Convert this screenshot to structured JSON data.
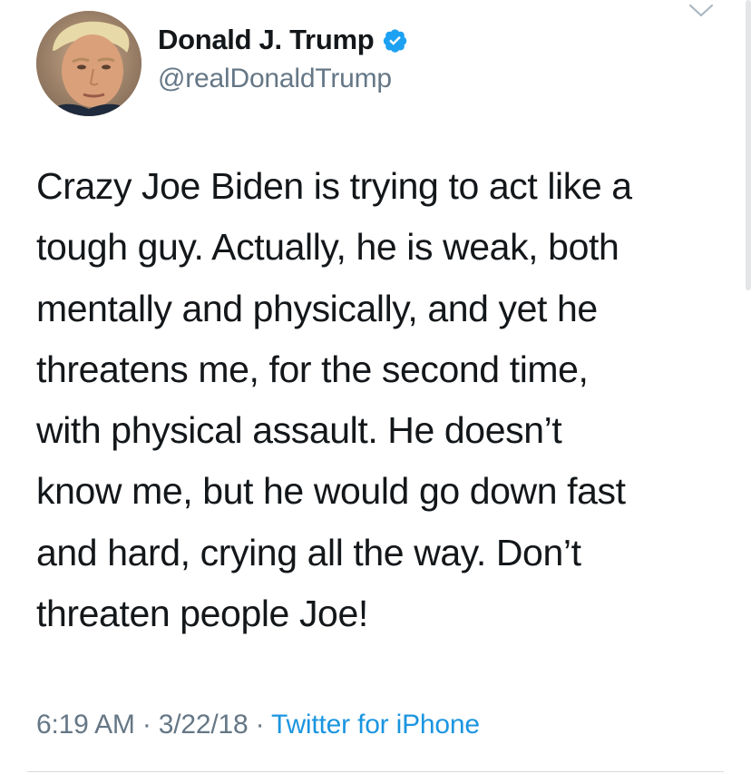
{
  "tweet": {
    "author": {
      "name": "Donald J. Trump",
      "handle": "@realDonaldTrump",
      "verified": true,
      "avatar_icon": "profile-photo"
    },
    "text": "Crazy Joe Biden is trying to act like a\ntough guy. Actually, he is weak, both\nmentally and physically, and yet he\nthreatens me, for the second time,\nwith physical assault. He doesn’t\nknow me, but he would go down fast\nand hard, crying all the way. Don’t\nthreaten people Joe!",
    "time": "6:19 AM",
    "date": "3/22/18",
    "separator": "·",
    "source": "Twitter for iPhone"
  },
  "icons": {
    "verified": "verified-badge-icon",
    "menu": "chevron-down-icon"
  },
  "colors": {
    "text_primary": "#14171a",
    "text_secondary": "#657786",
    "link": "#1b95e0",
    "verified": "#1da1f2"
  }
}
